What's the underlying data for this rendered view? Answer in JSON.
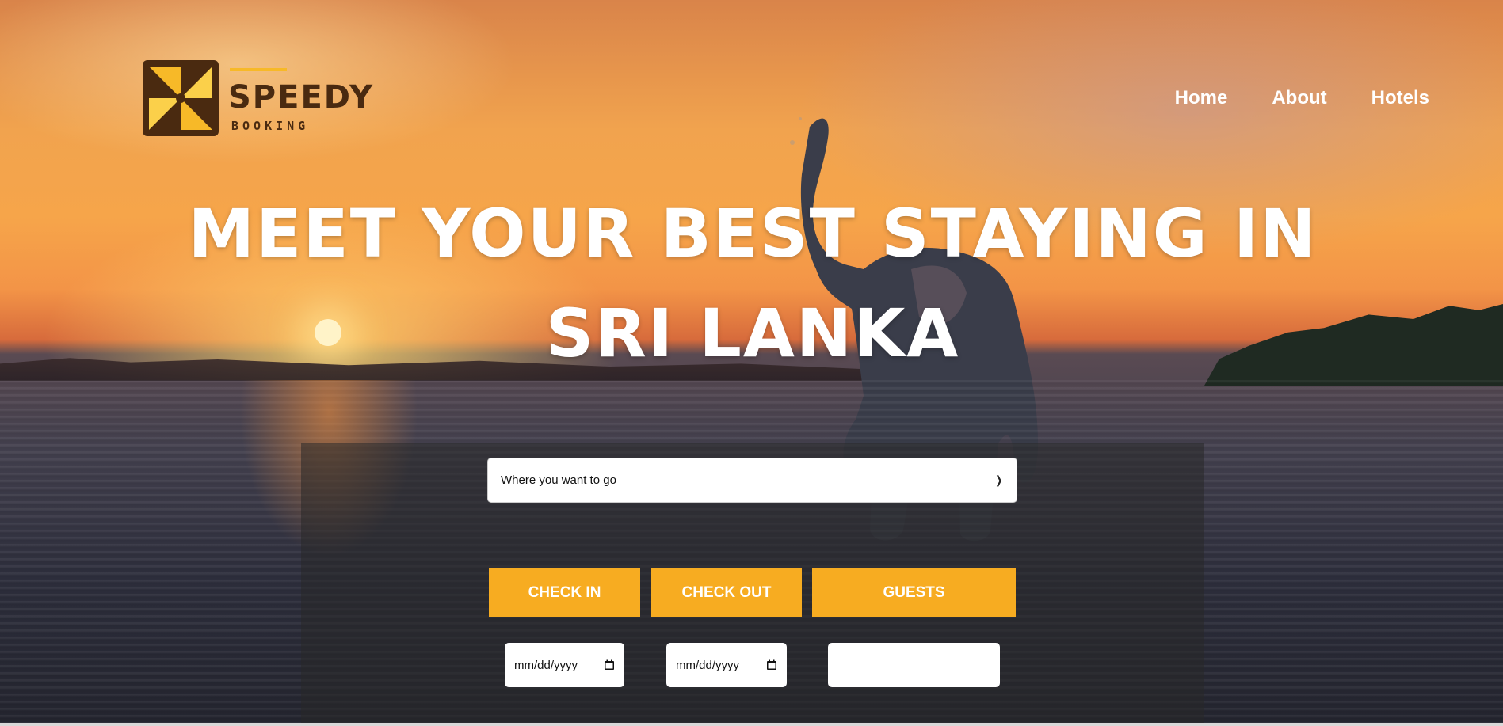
{
  "brand": {
    "name": "SPEEDY",
    "subtitle": "BOOKING",
    "colors": {
      "accent": "#f7ac21",
      "logo_dark": "#4a2a10"
    }
  },
  "nav": {
    "items": [
      {
        "label": "Home"
      },
      {
        "label": "About"
      },
      {
        "label": "Hotels"
      }
    ]
  },
  "hero": {
    "headline": "MEET YOUR BEST STAYING IN SRI LANKA"
  },
  "search": {
    "destination_selected": "Where you want to go",
    "tabs": {
      "check_in": "CHECK IN",
      "check_out": "CHECK OUT",
      "guests": "GUESTS"
    },
    "check_in_value": "mm/dd/yyyy",
    "check_out_value": "mm/dd/yyyy",
    "guests_value": ""
  },
  "icons": {
    "select": "chevron-down-icon",
    "date": "calendar-icon"
  }
}
